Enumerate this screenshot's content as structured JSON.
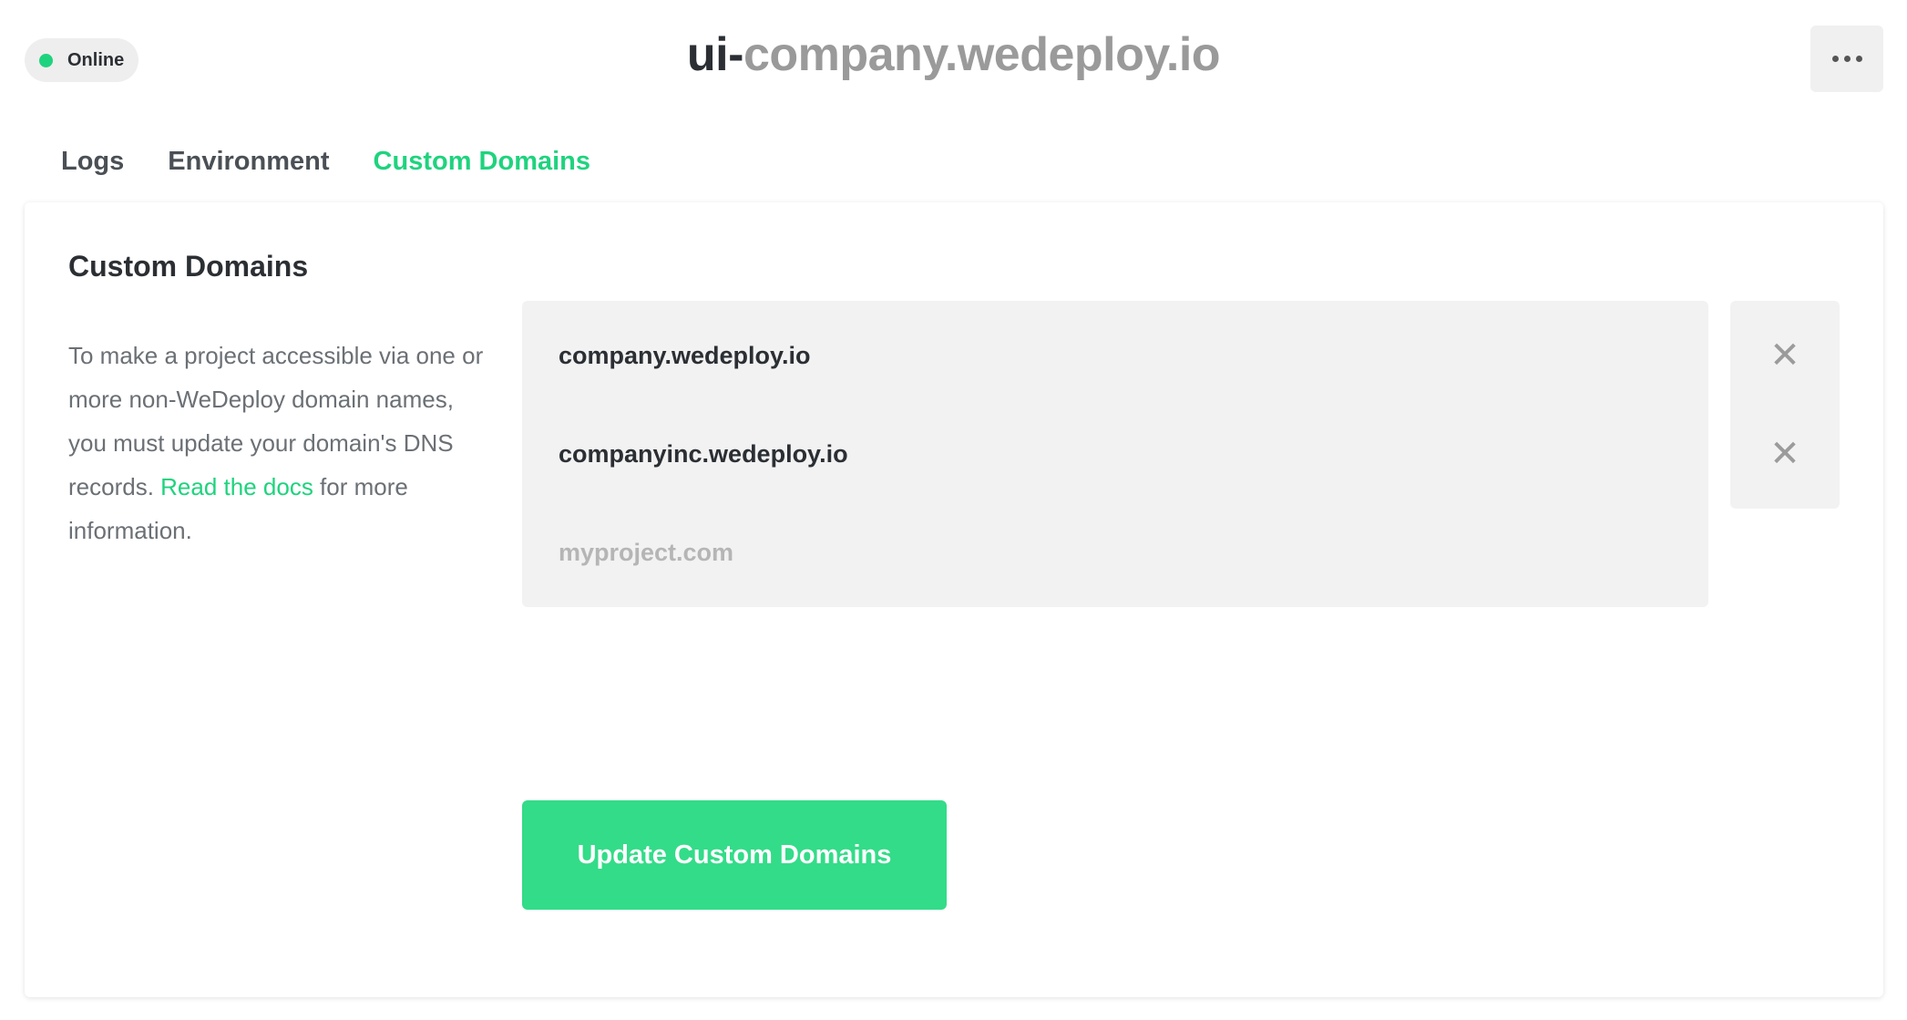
{
  "status": {
    "label": "Online",
    "color": "#1fd37e"
  },
  "title": {
    "prefix": "ui-",
    "host": "company.wedeploy.io"
  },
  "menu": {
    "icon": "more-horizontal-icon"
  },
  "tabs": [
    {
      "label": "Logs",
      "active": false
    },
    {
      "label": "Environment",
      "active": false
    },
    {
      "label": "Custom Domains",
      "active": true
    }
  ],
  "card": {
    "title": "Custom Domains",
    "description": {
      "before_link": "To make a project accessible via one or more non-WeDeploy domain names, you must update your domain's DNS records. ",
      "link": "Read the docs",
      "after_link": " for more information."
    },
    "domains": [
      {
        "value": "company.wedeploy.io",
        "remove_icon": "close-icon"
      },
      {
        "value": "companyinc.wedeploy.io",
        "remove_icon": "close-icon"
      }
    ],
    "new_domain": {
      "placeholder": "myproject.com"
    },
    "submit_label": "Update Custom Domains"
  },
  "colors": {
    "accent": "#1fd37e",
    "button": "#33dc88",
    "field_bg": "#f2f2f2"
  }
}
